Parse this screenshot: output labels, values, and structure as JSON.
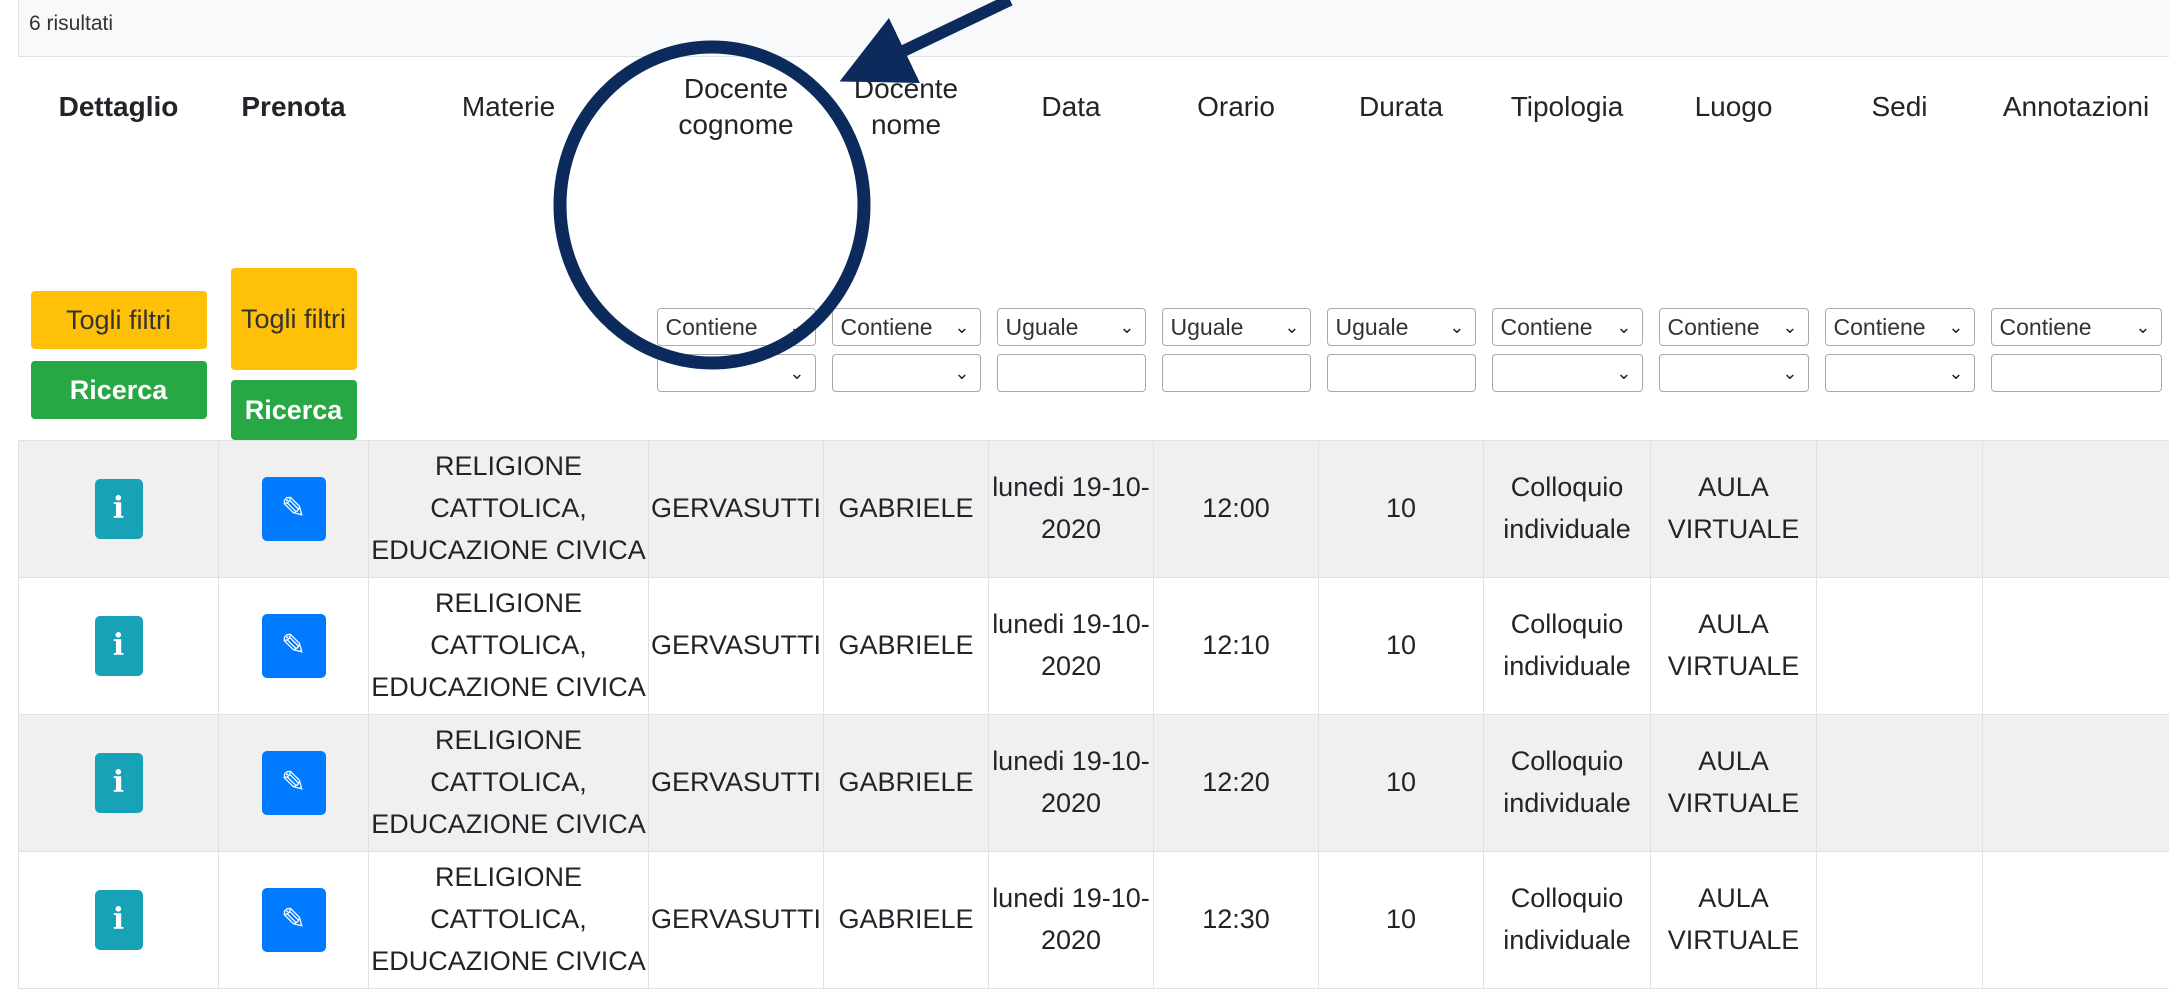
{
  "results": {
    "count_text": "6 risultati"
  },
  "columns": [
    {
      "key": "dettaglio",
      "label": "Dettaglio",
      "bold": true
    },
    {
      "key": "prenota",
      "label": "Prenota",
      "bold": true
    },
    {
      "key": "materie",
      "label": "Materie",
      "bold": false
    },
    {
      "key": "docente_cognome",
      "label": "Docente cognome",
      "bold": false
    },
    {
      "key": "docente_nome",
      "label": "Docente nome",
      "bold": false
    },
    {
      "key": "data",
      "label": "Data",
      "bold": false
    },
    {
      "key": "orario",
      "label": "Orario",
      "bold": false
    },
    {
      "key": "durata",
      "label": "Durata",
      "bold": false
    },
    {
      "key": "tipologia",
      "label": "Tipologia",
      "bold": false
    },
    {
      "key": "luogo",
      "label": "Luogo",
      "bold": false
    },
    {
      "key": "sedi",
      "label": "Sedi",
      "bold": false
    },
    {
      "key": "annotazioni",
      "label": "Annotazioni",
      "bold": false
    }
  ],
  "filter_buttons": {
    "clear_label": "Togli filtri",
    "search_label": "Ricerca"
  },
  "filters": {
    "docente_cognome": "Contiene",
    "docente_nome": "Contiene",
    "data": "Uguale",
    "orario": "Uguale",
    "durata": "Uguale",
    "tipologia": "Contiene",
    "luogo": "Contiene",
    "sedi": "Contiene",
    "annotazioni": "Contiene"
  },
  "icons": {
    "info": "i",
    "edit": "✎"
  },
  "rows": [
    {
      "materie": "RELIGIONE CATTOLICA, EDUCAZIONE CIVICA",
      "cognome": "GERVASUTTI",
      "nome": "GABRIELE",
      "data": "lunedi 19-10-2020",
      "orario": "12:00",
      "durata": "10",
      "tipologia": "Colloquio individuale",
      "luogo": "AULA VIRTUALE",
      "sedi": "",
      "annotazioni": ""
    },
    {
      "materie": "RELIGIONE CATTOLICA, EDUCAZIONE CIVICA",
      "cognome": "GERVASUTTI",
      "nome": "GABRIELE",
      "data": "lunedi 19-10-2020",
      "orario": "12:10",
      "durata": "10",
      "tipologia": "Colloquio individuale",
      "luogo": "AULA VIRTUALE",
      "sedi": "",
      "annotazioni": ""
    },
    {
      "materie": "RELIGIONE CATTOLICA, EDUCAZIONE CIVICA",
      "cognome": "GERVASUTTI",
      "nome": "GABRIELE",
      "data": "lunedi 19-10-2020",
      "orario": "12:20",
      "durata": "10",
      "tipologia": "Colloquio individuale",
      "luogo": "AULA VIRTUALE",
      "sedi": "",
      "annotazioni": ""
    },
    {
      "materie": "RELIGIONE CATTOLICA, EDUCAZIONE CIVICA",
      "cognome": "GERVASUTTI",
      "nome": "GABRIELE",
      "data": "lunedi 19-10-2020",
      "orario": "12:30",
      "durata": "10",
      "tipologia": "Colloquio individuale",
      "luogo": "AULA VIRTUALE",
      "sedi": "",
      "annotazioni": ""
    }
  ],
  "colors": {
    "info_button": "#17a2b8",
    "edit_button": "#007bff",
    "clear_button": "#ffc107",
    "search_button": "#28a745",
    "annotation": "#0d2a5c"
  }
}
